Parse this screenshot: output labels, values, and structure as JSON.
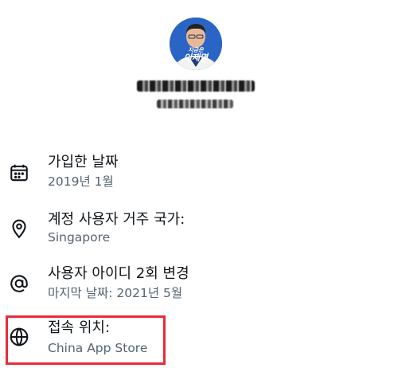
{
  "profile": {
    "avatar_badge_line1": "지금은",
    "avatar_badge_line2": "이재명"
  },
  "info_rows": [
    {
      "icon": "calendar-icon",
      "title": "가입한 날짜",
      "value": "2019년 1월"
    },
    {
      "icon": "location-pin-icon",
      "title": "계정 사용자 거주 국가:",
      "value": "Singapore"
    },
    {
      "icon": "at-sign-icon",
      "title": "사용자 아이디 2회 변경",
      "value": "마지막 날짜: 2021년 5월"
    },
    {
      "icon": "globe-icon",
      "title": "접속 위치:",
      "value": "China App Store"
    }
  ],
  "colors": {
    "primary_text": "#0f1419",
    "secondary_text": "#536471",
    "highlight_border": "#e62d3a",
    "avatar_background": "#1d57b8"
  }
}
